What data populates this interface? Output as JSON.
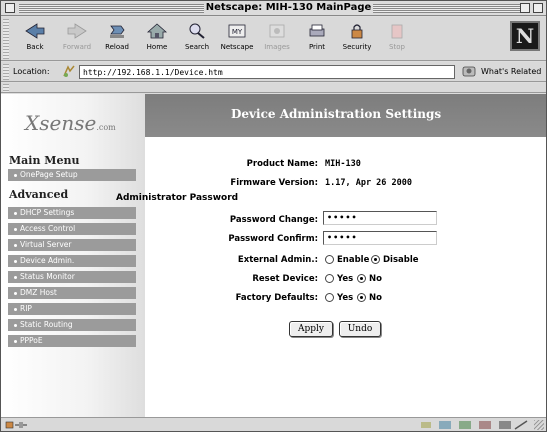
{
  "window": {
    "title": "Netscape: MIH-130 MainPage"
  },
  "toolbar": {
    "buttons": [
      {
        "label": "Back",
        "enabled": true
      },
      {
        "label": "Forward",
        "enabled": false
      },
      {
        "label": "Reload",
        "enabled": true
      },
      {
        "label": "Home",
        "enabled": true
      },
      {
        "label": "Search",
        "enabled": true
      },
      {
        "label": "Netscape",
        "enabled": true
      },
      {
        "label": "Images",
        "enabled": false
      },
      {
        "label": "Print",
        "enabled": true
      },
      {
        "label": "Security",
        "enabled": true
      },
      {
        "label": "Stop",
        "enabled": false
      }
    ],
    "brand_letter": "N"
  },
  "location": {
    "label": "Location:",
    "url": "http://192.168.1.1/Device.htm",
    "related": "What's Related"
  },
  "sidebar": {
    "logo_text": "Xsense",
    "logo_suffix": ".com",
    "main_menu_heading": "Main Menu",
    "main_items": [
      {
        "label": "OnePage Setup"
      }
    ],
    "advanced_heading": "Advanced",
    "advanced_items": [
      {
        "label": "DHCP Settings"
      },
      {
        "label": "Access Control"
      },
      {
        "label": "Virtual Server"
      },
      {
        "label": "Device Admin."
      },
      {
        "label": "Status Monitor"
      },
      {
        "label": "DMZ Host"
      },
      {
        "label": "RIP"
      },
      {
        "label": "Static Routing"
      },
      {
        "label": "PPPoE"
      }
    ]
  },
  "page": {
    "title": "Device Administration Settings",
    "product_name_label": "Product Name:",
    "product_name_value": "MIH-130",
    "firmware_label": "Firmware Version:",
    "firmware_value": "1.17, Apr 26 2000",
    "admin_password_heading": "Administrator Password",
    "password_change_label": "Password Change:",
    "password_change_value": "•••••",
    "password_confirm_label": "Password Confirm:",
    "password_confirm_value": "•••••",
    "external_admin_label": "External Admin.:",
    "external_admin_options": [
      "Enable",
      "Disable"
    ],
    "external_admin_selected": "Disable",
    "reset_device_label": "Reset Device:",
    "reset_device_options": [
      "Yes",
      "No"
    ],
    "reset_device_selected": "No",
    "factory_defaults_label": "Factory Defaults:",
    "factory_defaults_options": [
      "Yes",
      "No"
    ],
    "factory_defaults_selected": "No",
    "apply_label": "Apply",
    "undo_label": "Undo"
  },
  "colors": {
    "banner": "#7d7d7d",
    "menu_item_bg": "#9b9b9b",
    "chrome": "#d9d9d9"
  }
}
